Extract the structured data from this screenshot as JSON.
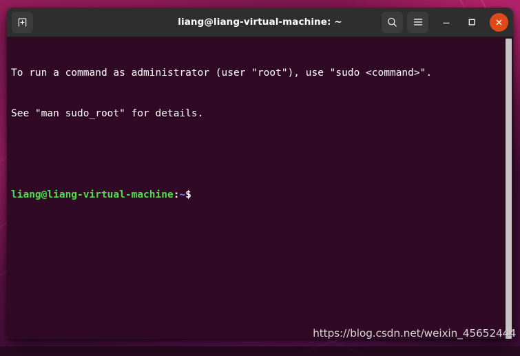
{
  "window": {
    "title": "liang@liang-virtual-machine: ~"
  },
  "titlebar": {
    "new_tab_label": "",
    "search_label": "",
    "menu_label": "",
    "minimize_label": "",
    "maximize_label": "",
    "close_label": ""
  },
  "terminal": {
    "line1": "To run a command as administrator (user \"root\"), use \"sudo <command>\".",
    "line2": "See \"man sudo_root\" for details.",
    "prompt_user": "liang@liang-virtual-machine",
    "prompt_colon": ":",
    "prompt_path": "~",
    "prompt_sigil": "$",
    "background_color": "#300a24",
    "text_color": "#ffffff",
    "user_color": "#4ddc4d",
    "path_color": "#6a8fe8"
  },
  "watermark": {
    "text": "https://blog.csdn.net/weixin_45652444"
  },
  "colors": {
    "titlebar": "#2e2e2e",
    "button": "#3b3b3b",
    "close": "#e04a1a",
    "scrollbar": "#c8c4c6"
  }
}
